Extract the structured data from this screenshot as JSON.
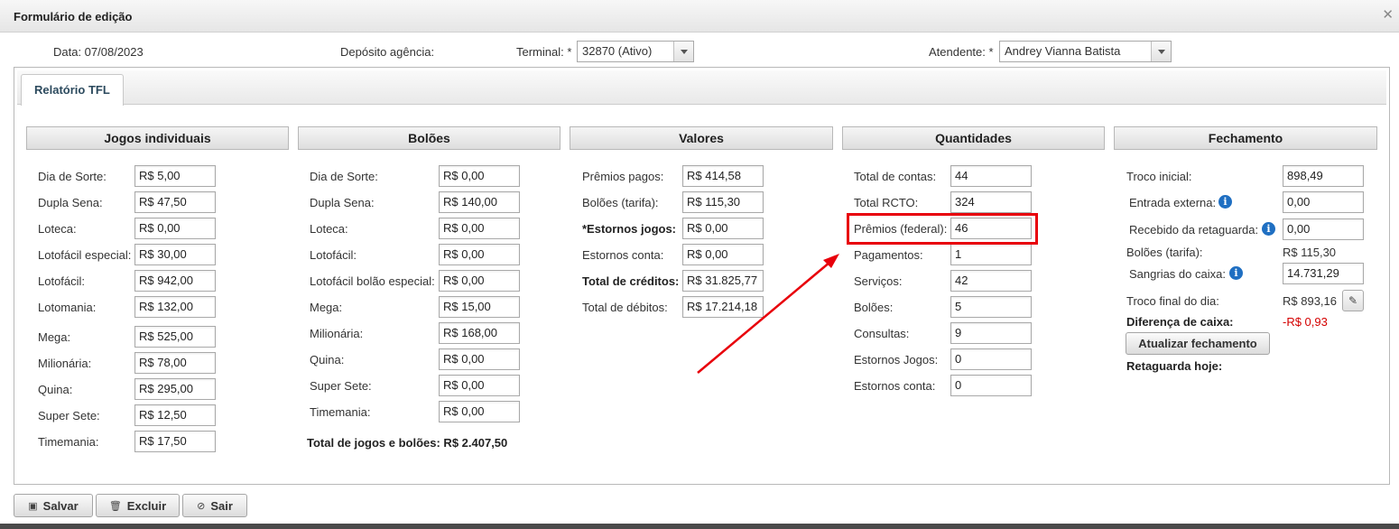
{
  "window": {
    "title": "Formulário de edição"
  },
  "top": {
    "data_label": "Data: 07/08/2023",
    "deposito_label": "Depósito agência:",
    "terminal_label": "Terminal: *",
    "terminal_value": "32870 (Ativo)",
    "atendente_label": "Atendente: *",
    "atendente_value": "Andrey Vianna Batista"
  },
  "tabs": [
    "Relatório TFL"
  ],
  "jogos": {
    "header": "Jogos individuais",
    "rows": [
      {
        "label": "Dia de Sorte:",
        "value": "R$ 5,00"
      },
      {
        "label": "Dupla Sena:",
        "value": "R$ 47,50"
      },
      {
        "label": "Loteca:",
        "value": "R$ 0,00"
      },
      {
        "label": "Lotofácil especial:",
        "value": "R$ 30,00"
      },
      {
        "label": "Lotofácil:",
        "value": "R$ 942,00"
      },
      {
        "label": "Lotomania:",
        "value": "R$ 132,00"
      },
      {
        "label": "Mega:",
        "value": "R$ 525,00"
      },
      {
        "label": "Milionária:",
        "value": "R$ 78,00"
      },
      {
        "label": "Quina:",
        "value": "R$ 295,00"
      },
      {
        "label": "Super Sete:",
        "value": "R$ 12,50"
      },
      {
        "label": "Timemania:",
        "value": "R$ 17,50"
      }
    ]
  },
  "boloes": {
    "header": "Bolões",
    "rows": [
      {
        "label": "Dia de Sorte:",
        "value": "R$ 0,00"
      },
      {
        "label": "Dupla Sena:",
        "value": "R$ 140,00"
      },
      {
        "label": "Loteca:",
        "value": "R$ 0,00"
      },
      {
        "label": "Lotofácil:",
        "value": "R$ 0,00"
      },
      {
        "label": "Lotofácil bolão especial:",
        "value": "R$ 0,00"
      },
      {
        "label": "Mega:",
        "value": "R$ 15,00"
      },
      {
        "label": "Milionária:",
        "value": "R$ 168,00"
      },
      {
        "label": "Quina:",
        "value": "R$ 0,00"
      },
      {
        "label": "Super Sete:",
        "value": "R$ 0,00"
      },
      {
        "label": "Timemania:",
        "value": "R$ 0,00"
      }
    ],
    "total": "Total de jogos e bolões: R$ 2.407,50"
  },
  "valores": {
    "header": "Valores",
    "rows": [
      {
        "label": "Prêmios pagos:",
        "value": "R$ 414,58"
      },
      {
        "label": "Bolões (tarifa):",
        "value": "R$ 115,30"
      },
      {
        "label": "*Estornos jogos:",
        "value": "R$ 0,00"
      },
      {
        "label": "Estornos conta:",
        "value": "R$ 0,00"
      },
      {
        "label": "Total de créditos:",
        "value": "R$ 31.825,77"
      },
      {
        "label": "Total de débitos:",
        "value": "R$ 17.214,18"
      }
    ]
  },
  "quantidades": {
    "header": "Quantidades",
    "rows": [
      {
        "label": "Total de contas:",
        "value": "44"
      },
      {
        "label": "Total RCTO:",
        "value": "324"
      },
      {
        "label": "Prêmios (federal):",
        "value": "46"
      },
      {
        "label": "Pagamentos:",
        "value": "1"
      },
      {
        "label": "Serviços:",
        "value": "42"
      },
      {
        "label": "Bolões:",
        "value": "5"
      },
      {
        "label": "Consultas:",
        "value": "9"
      },
      {
        "label": "Estornos Jogos:",
        "value": "0"
      },
      {
        "label": "Estornos conta:",
        "value": "0"
      }
    ]
  },
  "fechamento": {
    "header": "Fechamento",
    "troco_inicial_label": "Troco inicial:",
    "troco_inicial_value": "898,49",
    "entrada_externa_label": "Entrada externa:",
    "entrada_externa_value": "0,00",
    "recebido_label": "Recebido da retaguarda:",
    "recebido_value": "0,00",
    "boloes_tarifa_label": "Bolões (tarifa):",
    "boloes_tarifa_value": "R$ 115,30",
    "sangrias_label": "Sangrias do caixa:",
    "sangrias_value": "14.731,29",
    "troco_final_label": "Troco final do dia:",
    "troco_final_value": "R$ 893,16",
    "diferenca_label": "Diferença de caixa:",
    "diferenca_value": "-R$ 0,93",
    "atualizar_label": "Atualizar fechamento",
    "retaguarda_label": "Retaguarda hoje:"
  },
  "buttons": {
    "salvar": "Salvar",
    "excluir": "Excluir",
    "sair": "Sair"
  },
  "colors": {
    "highlight": "#e8000b",
    "accent": "#1f6fc2",
    "negative": "#d40000"
  },
  "icons": {
    "info": "info-icon",
    "edit": "pencil-icon",
    "save": "floppy-icon",
    "delete": "trash-icon",
    "exit": "no-entry-icon",
    "close": "close-icon"
  }
}
